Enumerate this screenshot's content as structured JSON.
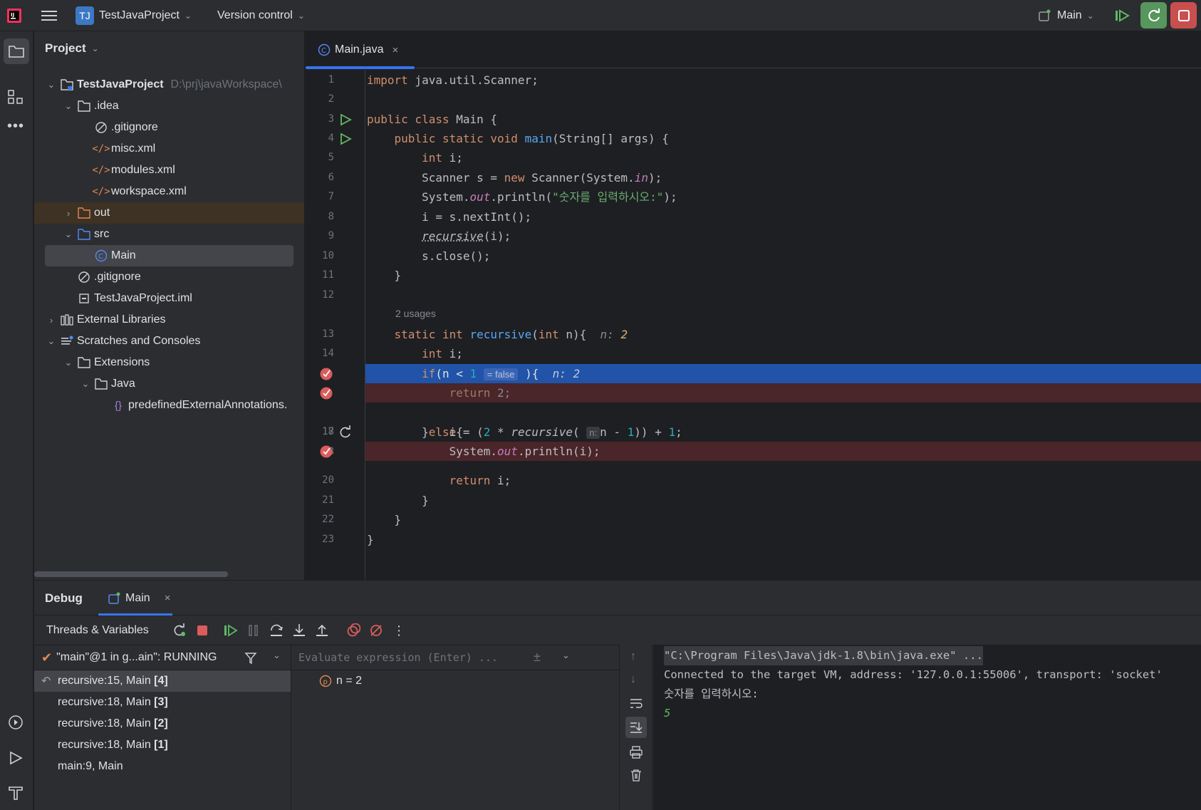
{
  "titlebar": {
    "app_icon": "intellij-logo",
    "project_badge": "TJ",
    "project_name": "TestJavaProject",
    "vcs_label": "Version control",
    "run_config": "Main"
  },
  "project_panel": {
    "title": "Project",
    "tree": [
      {
        "label": "TestJavaProject",
        "path": "D:\\prj\\javaWorkspace\\",
        "bold": true
      },
      {
        "label": ".idea"
      },
      {
        "label": ".gitignore"
      },
      {
        "label": "misc.xml"
      },
      {
        "label": "modules.xml"
      },
      {
        "label": "workspace.xml"
      },
      {
        "label": "out"
      },
      {
        "label": "src"
      },
      {
        "label": "Main"
      },
      {
        "label": ".gitignore"
      },
      {
        "label": "TestJavaProject.iml"
      },
      {
        "label": "External Libraries"
      },
      {
        "label": "Scratches and Consoles"
      },
      {
        "label": "Extensions"
      },
      {
        "label": "Java"
      },
      {
        "label": "predefinedExternalAnnotations."
      }
    ]
  },
  "editor": {
    "tab_label": "Main.java",
    "usages_hint": "2 usages",
    "line_numbers": [
      "1",
      "2",
      "3",
      "4",
      "5",
      "6",
      "7",
      "8",
      "9",
      "10",
      "11",
      "12",
      "13",
      "14",
      "",
      "",
      "17",
      "18",
      "",
      "20",
      "21",
      "22",
      "23"
    ],
    "inlay": {
      "n_hint": "n: 2",
      "false_hint": "= false",
      "param_hint": "n:"
    },
    "strings": {
      "prompt": "\"숫자를 입력하시오:\""
    }
  },
  "debug": {
    "tab_debug": "Debug",
    "tab_main": "Main",
    "threads_label": "Threads & Variables",
    "thread_status": "\"main\"@1 in g...ain\": RUNNING",
    "eval_placeholder": "Evaluate expression (Enter) ...",
    "frames": [
      {
        "label": "recursive:15, Main",
        "depth": "[4]",
        "current": true
      },
      {
        "label": "recursive:18, Main",
        "depth": "[3]"
      },
      {
        "label": "recursive:18, Main",
        "depth": "[2]"
      },
      {
        "label": "recursive:18, Main",
        "depth": "[1]"
      },
      {
        "label": "main:9, Main",
        "depth": ""
      }
    ],
    "variable": "n = 2",
    "console": [
      "\"C:\\Program Files\\Java\\jdk-1.8\\bin\\java.exe\" ...",
      "Connected to the target VM, address: '127.0.0.1:55006', transport: 'socket'",
      "숫자를 입력하시오:",
      "5"
    ]
  },
  "colors": {
    "background": "#1e1f22",
    "panel": "#2b2d30",
    "accent": "#3574f0",
    "execution_line": "#2154a8",
    "breakpoint_line": "#4a2529",
    "breakpoint": "#db5c5c",
    "run_green": "#57965c",
    "stop_red": "#c94f4f"
  }
}
